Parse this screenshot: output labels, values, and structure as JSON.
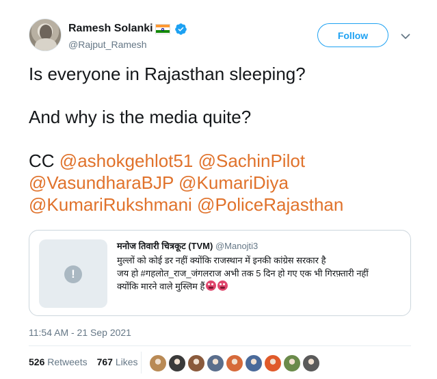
{
  "author": {
    "display_name": "Ramesh Solanki",
    "handle": "@Rajput_Ramesh",
    "verified": true,
    "flag": "india-flag-icon"
  },
  "header": {
    "follow_label": "Follow"
  },
  "tweet": {
    "line1": "Is everyone in Rajasthan sleeping?",
    "line2": "And why is the media quite?",
    "cc_label": "CC",
    "mentions": [
      "@ashokgehlot51",
      "@SachinPilot",
      "@VasundharaBJP",
      "@KumariDiya",
      "@KumariRukshmani",
      "@PoliceRajasthan"
    ],
    "timestamp": "11:54 AM - 21 Sep 2021"
  },
  "quoted_tweet": {
    "name": "मनोज तिवारी चित्रकूट (TVM)",
    "handle": "@Manojti3",
    "media_placeholder": "!",
    "line1": "मुल्लों को कोई डर नहीं क्योंकि राजस्थान में इनकी कांग्रेस सरकार है",
    "line2": "जय हो #गहलोत_राज_जंगलराज अभी तक 5 दिन हो गए एक भी गिरफ़्तारी नहीं",
    "line3": "क्योंकि मारने वाले मुस्लिम हैं"
  },
  "stats": {
    "retweets_count": "526",
    "retweets_label": "Retweets",
    "likes_count": "767",
    "likes_label": "Likes"
  },
  "colors": {
    "mention": "#e0722b",
    "accent": "#1da1f2",
    "secondary_text": "#657786"
  },
  "liker_avatars": [
    "#b98a55",
    "#3a3a3a",
    "#8a5a3c",
    "#5a6e8c",
    "#d66a3a",
    "#4a6a9a",
    "#e05a2a",
    "#6a8a4a",
    "#5a5a5a"
  ]
}
